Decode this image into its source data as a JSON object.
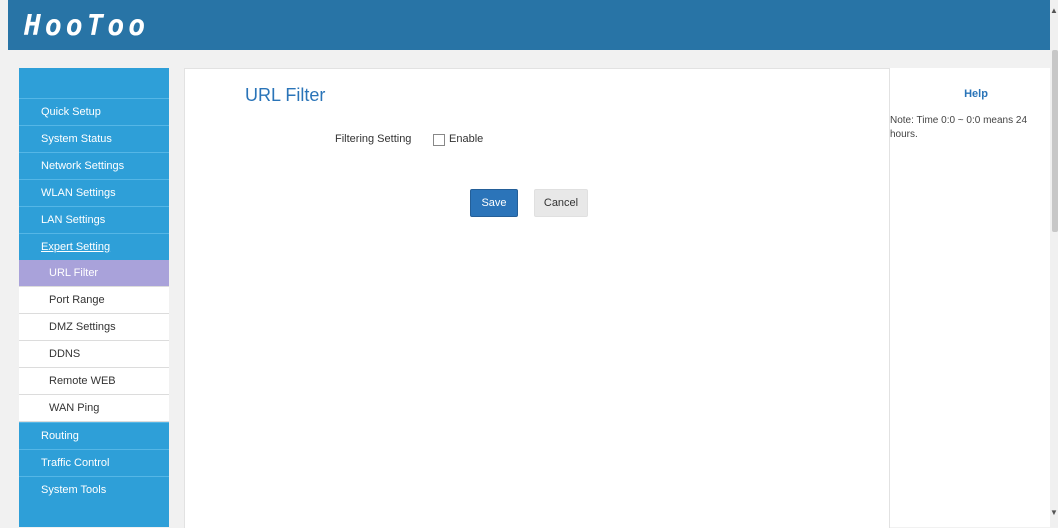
{
  "header": {
    "logo": "HooToo"
  },
  "sidebar": {
    "items_top": [
      {
        "label": "Quick Setup"
      },
      {
        "label": "System Status"
      },
      {
        "label": "Network Settings"
      },
      {
        "label": "WLAN Settings"
      },
      {
        "label": "LAN Settings"
      },
      {
        "label": "Expert Setting"
      }
    ],
    "sub_items": [
      {
        "label": "URL Filter"
      },
      {
        "label": "Port Range"
      },
      {
        "label": "DMZ Settings"
      },
      {
        "label": "DDNS"
      },
      {
        "label": "Remote WEB"
      },
      {
        "label": "WAN Ping"
      }
    ],
    "items_bottom": [
      {
        "label": "Routing"
      },
      {
        "label": "Traffic Control"
      },
      {
        "label": "System Tools"
      }
    ]
  },
  "main": {
    "title": "URL Filter",
    "filtering_label": "Filtering Setting",
    "enable_label": "Enable",
    "enable_checked": false,
    "save_label": "Save",
    "cancel_label": "Cancel"
  },
  "help": {
    "title": "Help",
    "note": "Note: Time 0:0 ~ 0:0 means 24 hours."
  },
  "colors": {
    "header_bg": "#2874a6",
    "sidebar_bg": "#2e9fd8",
    "active_sub_bg": "#a9a2da",
    "title": "#2a74b8",
    "save_button": "#2b74b9"
  }
}
